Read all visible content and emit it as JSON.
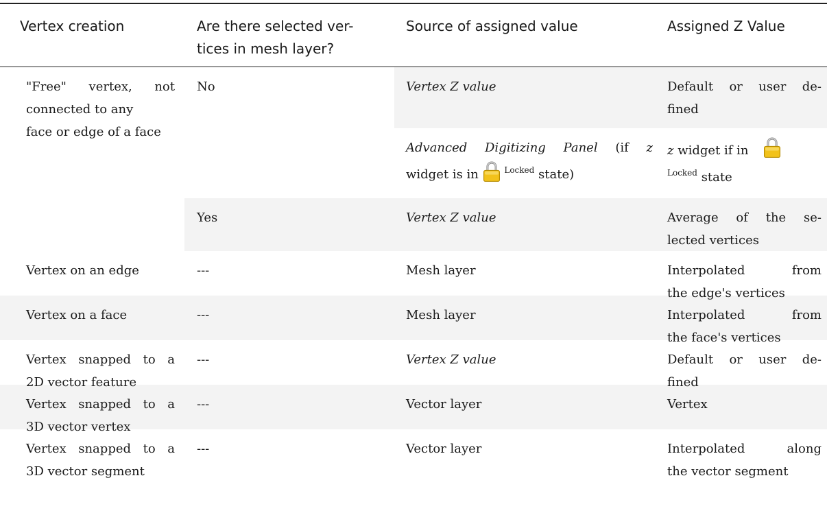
{
  "header": {
    "col1": "Vertex creation",
    "col2_line1": "Are there selected ver-",
    "col2_line2": "tices in mesh layer?",
    "col3": "Source of assigned value",
    "col4": "Assigned Z Value"
  },
  "rows": {
    "free": {
      "creation_l1": "\"Free\" vertex, not",
      "creation_l2": "connected to any",
      "creation_l3": "face or edge of a face",
      "no": {
        "selected": "No",
        "source_a": "Vertex Z value",
        "value_a_l1": "Default or user de-",
        "value_a_l2": "fined",
        "source_b_italic": "Advanced Digitizing Panel",
        "source_b_text1": " (if ",
        "source_b_z": "z",
        "source_b_text2": "widget is in ",
        "source_b_locked": "Locked",
        "source_b_text3": " state)",
        "value_b_z": "z",
        "value_b_text1": " widget if in ",
        "value_b_locked": "Locked",
        "value_b_text2": " state"
      },
      "yes": {
        "selected": "Yes",
        "source": "Vertex Z value",
        "value_l1": "Average of the se-",
        "value_l2": "lected vertices"
      }
    },
    "edge": {
      "creation": "Vertex on an edge",
      "selected": "---",
      "source": "Mesh layer",
      "value_l1": "Interpolated from",
      "value_l2": "the edge's vertices"
    },
    "face": {
      "creation": "Vertex on a face",
      "selected": "---",
      "source": "Mesh layer",
      "value_l1": "Interpolated from",
      "value_l2": "the face's vertices"
    },
    "snap2d": {
      "creation_l1": "Vertex snapped to a",
      "creation_l2": "2D vector feature",
      "selected": "---",
      "source": "Vertex Z value",
      "value_l1": "Default or user de-",
      "value_l2": "fined"
    },
    "snap3dv": {
      "creation_l1": "Vertex snapped to a",
      "creation_l2": "3D vector vertex",
      "selected": "---",
      "source": "Vector layer",
      "value": "Vertex"
    },
    "snap3ds": {
      "creation_l1": "Vertex snapped to a",
      "creation_l2": "3D vector segment",
      "selected": "---",
      "source": "Vector layer",
      "value_l1": "Interpolated along",
      "value_l2": "the vector segment"
    }
  },
  "icons": {
    "lock": "lock-icon",
    "lock_color": "#f2c21b"
  }
}
